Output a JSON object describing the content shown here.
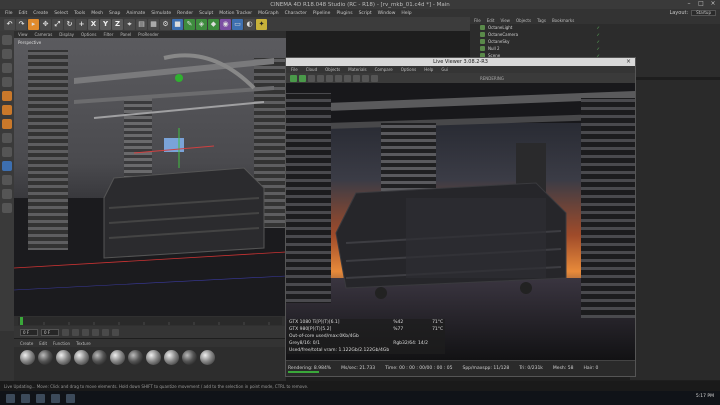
{
  "window": {
    "title": "CINEMA 4D R18.048 Studio (RC - R18) - [rv_mkb_01.c4d *] - Main"
  },
  "menu": [
    "File",
    "Edit",
    "Create",
    "Select",
    "Tools",
    "Mesh",
    "Snap",
    "Animate",
    "Simulate",
    "Render",
    "Sculpt",
    "Motion Tracker",
    "MoGraph",
    "Character",
    "Pipeline",
    "Plugins",
    "Script",
    "Window",
    "Help"
  ],
  "layout": {
    "label": "Layout:",
    "value": "Startup"
  },
  "toolbar": {
    "axes": [
      "X",
      "Y",
      "Z"
    ]
  },
  "viewport": {
    "menu": [
      "View",
      "Cameras",
      "Display",
      "Options",
      "Filter",
      "Panel",
      "ProRender"
    ],
    "label": "Perspective"
  },
  "timeline": {
    "frames": [
      "0 F",
      "0 F"
    ]
  },
  "material_manager": {
    "menu": [
      "Create",
      "Edit",
      "Function",
      "Texture"
    ]
  },
  "object_manager": {
    "menu": [
      "File",
      "Edit",
      "View",
      "Objects",
      "Tags",
      "Bookmarks"
    ],
    "objects": [
      "OctaneLight",
      "OctaneCamera",
      "OctaneSky",
      "Null 2",
      "Scene"
    ]
  },
  "live_viewer": {
    "title": "Live Viewer 3.08.2-R3",
    "menu": [
      "File",
      "Cloud",
      "Objects",
      "Materials",
      "Compare",
      "Options",
      "Help",
      "Gui"
    ],
    "status": "RENDERING",
    "stats": [
      [
        "GTX 1080 Ti[P](T)[6.1]",
        "%42",
        "71°C"
      ],
      [
        "GTX 980[P](T)[5.2]",
        "%77",
        "71°C"
      ],
      [
        "Out-of-core used/max:0Kb/4Gb",
        "",
        ""
      ],
      [
        "Grey8/16: 0/1",
        "Rgb32/64: 14/2",
        ""
      ],
      [
        "Used/free/total vram: 1.122Gb/2.122Gb/4Gb",
        "",
        ""
      ]
    ],
    "footer": {
      "rendering": "Rendering: 8.984%",
      "ms_sec": "Ms/sec: 21.733",
      "time": "Time: 00 : 00 : 00/00 : 00 : 05",
      "spp": "Spp/maxspp: 11/128",
      "tri": "Tri: 0/231k",
      "mesh": "Mesh: 58",
      "hair": "Hair: 0"
    },
    "progress": 0.09
  },
  "statusbar": {
    "text": "Live Updating... Move: Click and drag to move elements. Hold down SHIFT to quantize movement / add to the selection in point mode, CTRL to remove."
  },
  "clock": "5:17 PM",
  "colors": {
    "accent": "#e08a2c",
    "progress": "#3aa83a",
    "octane_green": "#4a9a4a"
  }
}
